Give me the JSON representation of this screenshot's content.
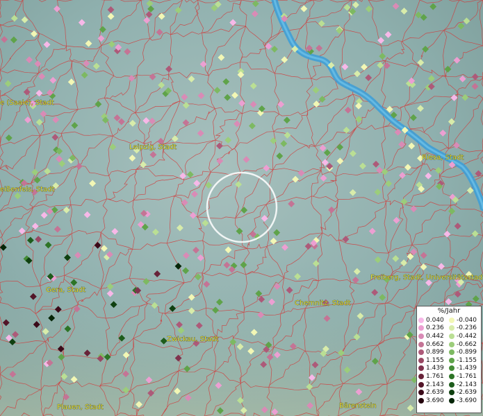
{
  "map": {
    "places": [
      {
        "name": "e (Saale), Stadt",
        "nx": 0,
        "ny": 151
      },
      {
        "name": "Leipzig, Stadt",
        "nx": 186,
        "ny": 215
      },
      {
        "name": "Riesa, Stadt",
        "nx": 607,
        "ny": 230
      },
      {
        "name": "eißenfels, Stadt",
        "nx": 0,
        "ny": 276
      },
      {
        "name": "Gera, Stadt",
        "nx": 66,
        "ny": 421
      },
      {
        "name": "Freiberg, Stadt, Universitätsstadt",
        "nx": 533,
        "ny": 403
      },
      {
        "name": "Chemnitz, Stadt",
        "nx": 424,
        "ny": 440
      },
      {
        "name": "Zwickau, Stadt",
        "nx": 240,
        "ny": 492
      },
      {
        "name": "Plauen, Stadt",
        "nx": 82,
        "ny": 590
      },
      {
        "name": "Bärenstein",
        "nx": 488,
        "ny": 588
      }
    ],
    "selection_circle": true,
    "colors": {
      "background": "#8fb0ae",
      "borders": "#d13a3a",
      "river": "#3f9fd6"
    }
  },
  "legend": {
    "title": "%/Jahr",
    "positive": [
      {
        "label": "0.040",
        "color": "#f7b8e8"
      },
      {
        "label": "0.236",
        "color": "#ec9fd2"
      },
      {
        "label": "0.442",
        "color": "#d98bb6"
      },
      {
        "label": "0.662",
        "color": "#c47495"
      },
      {
        "label": "0.899",
        "color": "#ad5a79"
      },
      {
        "label": "1.155",
        "color": "#984863"
      },
      {
        "label": "1.439",
        "color": "#7f334e"
      },
      {
        "label": "1.761",
        "color": "#682339"
      },
      {
        "label": "2.143",
        "color": "#521528"
      },
      {
        "label": "2.639",
        "color": "#3b0a19"
      },
      {
        "label": "3.690",
        "color": "#24030c"
      }
    ],
    "negative": [
      {
        "label": "-0.040",
        "color": "#f2f7b5"
      },
      {
        "label": "-0.236",
        "color": "#d8ecaa"
      },
      {
        "label": "-0.442",
        "color": "#badf94"
      },
      {
        "label": "-0.662",
        "color": "#9ccd7b"
      },
      {
        "label": "-0.899",
        "color": "#7db962"
      },
      {
        "label": "-1.155",
        "color": "#5fa34a"
      },
      {
        "label": "-1.439",
        "color": "#448c36"
      },
      {
        "label": "-1.761",
        "color": "#2d7426"
      },
      {
        "label": "-2.143",
        "color": "#1d5c1b"
      },
      {
        "label": "-2.639",
        "color": "#0f4010"
      },
      {
        "label": "-3.690",
        "color": "#052507"
      }
    ]
  }
}
